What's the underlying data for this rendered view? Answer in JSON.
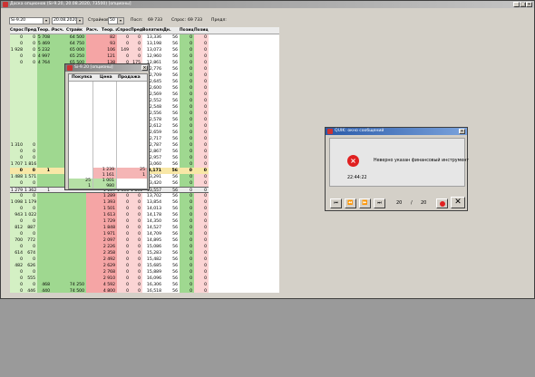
{
  "main_window": {
    "title": "Доска опционов (Si-9.20, 20.08.2020, 73500) [опционы]",
    "base_asset": "Si-9.20",
    "expiry": "20.08.2020",
    "strikes_label": "Страйков:",
    "strikes_value": "50",
    "last_label": "Посл:",
    "last_value": "69 733",
    "ask_label": "Спрос:",
    "ask_value": "69 733",
    "bid_label": "Предл:",
    "bid_value": ""
  },
  "columns": [
    "Спрос",
    "Предл",
    "Теор. цена",
    "Расч.",
    "Страйк",
    "Расч.",
    "Теор. цена",
    "Спрос",
    "Предл",
    "Волатильность",
    "Дн.",
    "Позиция",
    "Позиция"
  ],
  "grid_rows": [
    [
      "0",
      "0",
      "5 708",
      "",
      "64 500",
      "",
      "82",
      "0",
      "0",
      "13,336",
      "56",
      "0",
      "0"
    ],
    [
      "0",
      "0",
      "5 469",
      "",
      "64 750",
      "",
      "93",
      "0",
      "0",
      "13,198",
      "56",
      "0",
      "0"
    ],
    [
      "1 928",
      "0",
      "5 232",
      "",
      "65 000",
      "",
      "106",
      "149",
      "0",
      "13,073",
      "56",
      "0",
      "0"
    ],
    [
      "0",
      "0",
      "4 997",
      "",
      "65 250",
      "",
      "121",
      "0",
      "0",
      "12,960",
      "56",
      "0",
      "0"
    ],
    [
      "0",
      "0",
      "4 764",
      "",
      "65 500",
      "",
      "138",
      "0",
      "175",
      "12,861",
      "56",
      "0",
      "0"
    ],
    [
      "",
      "",
      "",
      "",
      "",
      "",
      "157",
      "0",
      "0",
      "12,776",
      "56",
      "0",
      "0"
    ],
    [
      "",
      "",
      "",
      "",
      "",
      "",
      "179",
      "0",
      "0",
      "12,709",
      "56",
      "0",
      "0"
    ],
    [
      "",
      "",
      "",
      "",
      "",
      "",
      "202",
      "0",
      "0",
      "12,645",
      "56",
      "0",
      "0"
    ],
    [
      "",
      "",
      "",
      "",
      "",
      "",
      "229",
      "181",
      "311",
      "12,600",
      "56",
      "0",
      "0"
    ],
    [
      "",
      "",
      "",
      "",
      "",
      "",
      "259",
      "0",
      "0",
      "12,569",
      "56",
      "0",
      "0"
    ],
    [
      "",
      "",
      "",
      "",
      "",
      "",
      "292",
      "278",
      "328",
      "12,552",
      "56",
      "0",
      "0"
    ],
    [
      "",
      "",
      "",
      "",
      "",
      "",
      "329",
      "0",
      "0",
      "12,548",
      "56",
      "0",
      "0"
    ],
    [
      "",
      "",
      "",
      "",
      "",
      "",
      "369",
      "379",
      "441",
      "12,556",
      "56",
      "0",
      "0"
    ],
    [
      "",
      "",
      "",
      "",
      "",
      "",
      "413",
      "0",
      "0",
      "12,578",
      "56",
      "0",
      "0"
    ],
    [
      "",
      "",
      "",
      "",
      "",
      "",
      "462",
      "513",
      "580",
      "12,612",
      "56",
      "0",
      "0"
    ],
    [
      "",
      "",
      "",
      "",
      "",
      "",
      "515",
      "0",
      "0",
      "12,659",
      "56",
      "0",
      "0"
    ],
    [
      "",
      "",
      "",
      "",
      "",
      "",
      "572",
      "672",
      "749",
      "12,717",
      "56",
      "0",
      "0"
    ],
    [
      "1 310",
      "0",
      "",
      "",
      "",
      "",
      "633",
      "0",
      "0",
      "12,787",
      "56",
      "0",
      "0"
    ],
    [
      "0",
      "0",
      "",
      "",
      "",
      "",
      "699",
      "867",
      "949",
      "12,867",
      "56",
      "0",
      "0"
    ],
    [
      "0",
      "0",
      "",
      "",
      "",
      "",
      "768",
      "0",
      "0",
      "12,957",
      "56",
      "0",
      "0"
    ],
    [
      "1 707",
      "1 816",
      "",
      "",
      "",
      "",
      "842",
      "1 104",
      "1 181",
      "13,060",
      "56",
      "0",
      "0"
    ],
    [
      "0",
      "0",
      "1",
      "",
      "",
      "",
      "0",
      "0",
      "0",
      "13,171",
      "56",
      "0",
      "0"
    ],
    [
      "1 488",
      "1 571",
      "",
      "",
      "",
      "",
      "1 005",
      "1 364",
      "1 442",
      "13,291",
      "56",
      "0",
      "0"
    ],
    [
      "0",
      "0",
      "",
      "",
      "",
      "",
      "1 095",
      "0",
      "0",
      "13,420",
      "56",
      "0",
      "0"
    ],
    [
      "1 279",
      "1 362",
      "1",
      "",
      "",
      "",
      "1 189",
      "1 505",
      "1 831",
      "13,557",
      "56",
      "0",
      "0"
    ],
    [
      "0",
      "0",
      "",
      "",
      "",
      "",
      "1 289",
      "0",
      "0",
      "13,702",
      "56",
      "0",
      "0"
    ],
    [
      "1 098",
      "1 179",
      "",
      "",
      "",
      "",
      "1 393",
      "0",
      "0",
      "13,854",
      "56",
      "0",
      "0"
    ],
    [
      "0",
      "0",
      "",
      "",
      "",
      "",
      "1 501",
      "0",
      "0",
      "14,013",
      "56",
      "0",
      "0"
    ],
    [
      "943",
      "1 022",
      "",
      "",
      "",
      "",
      "1 613",
      "0",
      "0",
      "14,178",
      "56",
      "0",
      "0"
    ],
    [
      "0",
      "0",
      "",
      "",
      "",
      "",
      "1 729",
      "0",
      "0",
      "14,350",
      "56",
      "0",
      "0"
    ],
    [
      "812",
      "887",
      "",
      "",
      "",
      "",
      "1 848",
      "0",
      "0",
      "14,527",
      "56",
      "0",
      "0"
    ],
    [
      "0",
      "0",
      "",
      "",
      "",
      "",
      "1 971",
      "0",
      "0",
      "14,709",
      "56",
      "0",
      "0"
    ],
    [
      "700",
      "772",
      "",
      "",
      "",
      "",
      "2 097",
      "0",
      "0",
      "14,895",
      "56",
      "0",
      "0"
    ],
    [
      "0",
      "0",
      "",
      "",
      "",
      "",
      "2 226",
      "0",
      "0",
      "15,086",
      "56",
      "0",
      "0"
    ],
    [
      "614",
      "674",
      "",
      "",
      "",
      "",
      "2 358",
      "0",
      "0",
      "15,283",
      "56",
      "0",
      "0"
    ],
    [
      "0",
      "0",
      "",
      "",
      "",
      "",
      "2 492",
      "0",
      "0",
      "15,482",
      "56",
      "0",
      "0"
    ],
    [
      "482",
      "626",
      "",
      "",
      "",
      "",
      "2 629",
      "0",
      "0",
      "15,685",
      "56",
      "0",
      "0"
    ],
    [
      "0",
      "0",
      "",
      "",
      "",
      "",
      "2 768",
      "0",
      "0",
      "15,889",
      "56",
      "0",
      "0"
    ],
    [
      "0",
      "555",
      "",
      "",
      "",
      "",
      "2 910",
      "0",
      "0",
      "16,096",
      "56",
      "0",
      "0"
    ],
    [
      "0",
      "0",
      "468",
      "",
      "74 250",
      "",
      "4 592",
      "0",
      "0",
      "16,306",
      "56",
      "0",
      "0"
    ],
    [
      "0",
      "446",
      "440",
      "",
      "74 500",
      "",
      "4 800",
      "0",
      "0",
      "16,518",
      "56",
      "0",
      "0"
    ],
    [
      "0",
      "0",
      "415",
      "",
      "74 750",
      "",
      "5 014",
      "0",
      "0",
      "16,732",
      "56",
      "0",
      "0"
    ]
  ],
  "orderbook": {
    "title": "Si-9.20 [опционы]",
    "col_buy": "Покупка",
    "col_price": "Цена",
    "col_sell": "Продажа",
    "rows": [
      {
        "buy": "",
        "price": "1 239",
        "sell": "25"
      },
      {
        "buy": "",
        "price": "1 161",
        "sell": "1"
      },
      {
        "buy": "25",
        "price": "1 001",
        "sell": ""
      },
      {
        "buy": "1",
        "price": "980",
        "sell": ""
      }
    ]
  },
  "message_window": {
    "title": "QUIK: окно сообщений",
    "message": "Неверно указан финансовый инструмент",
    "time": "22:44:22",
    "page_current": "20",
    "page_sep": "/",
    "page_total": "20"
  },
  "colors": {
    "bid_green": "#9fd890",
    "ask_red": "#f5a5a5",
    "strike_yellow": "#f8e7a6",
    "error_red": "#e02020"
  }
}
